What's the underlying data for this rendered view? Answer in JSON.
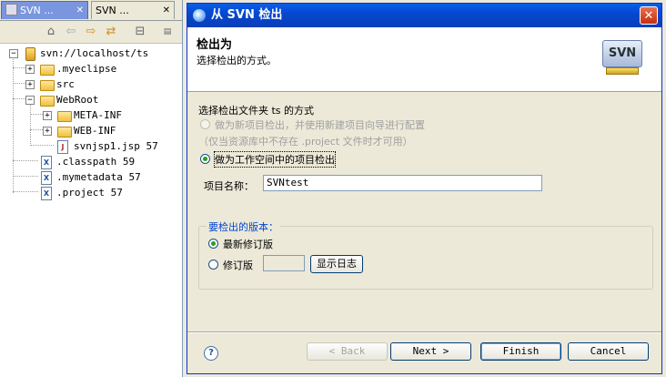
{
  "explorer": {
    "tabs": [
      {
        "label": "SVN ...",
        "active": true
      },
      {
        "label": "SVN ...",
        "active": false
      }
    ],
    "tree": [
      {
        "label": "svn://localhost/ts",
        "level": 0,
        "type": "repo",
        "expanded": true
      },
      {
        "label": ".myeclipse",
        "level": 1,
        "type": "folder",
        "expanded": false
      },
      {
        "label": "src",
        "level": 1,
        "type": "folder",
        "expanded": false
      },
      {
        "label": "WebRoot",
        "level": 1,
        "type": "folder",
        "expanded": true
      },
      {
        "label": "META-INF",
        "level": 2,
        "type": "folder",
        "expanded": false
      },
      {
        "label": "WEB-INF",
        "level": 2,
        "type": "folder",
        "expanded": false
      },
      {
        "label": "svnjsp1.jsp 57",
        "level": 2,
        "type": "jsp"
      },
      {
        "label": ".classpath 59",
        "level": 1,
        "type": "xml"
      },
      {
        "label": ".mymetadata 57",
        "level": 1,
        "type": "xml"
      },
      {
        "label": ".project 57",
        "level": 1,
        "type": "xml"
      }
    ]
  },
  "dialog": {
    "title": "从 SVN 检出",
    "header_title": "检出为",
    "header_subtitle": "选择检出的方式。",
    "logo_text": "SVN",
    "prompt": "选择检出文件夹 ts 的方式",
    "option_new_project": "做为新项目检出，并使用新建项目向导进行配置",
    "option_new_project_note": "（仅当资源库中不存在 .project 文件时才可用）",
    "option_workspace": "做为工作空间中的项目检出",
    "project_name_label": "项目名称：",
    "project_name_value": "SVNtest",
    "version_group": "要检出的版本：",
    "option_head": "最新修订版",
    "option_revision": "修订版",
    "revision_value": "",
    "show_log": "显示日志",
    "buttons": {
      "help": "?",
      "back": "< Back",
      "next": "Next >",
      "finish": "Finish",
      "cancel": "Cancel"
    }
  }
}
